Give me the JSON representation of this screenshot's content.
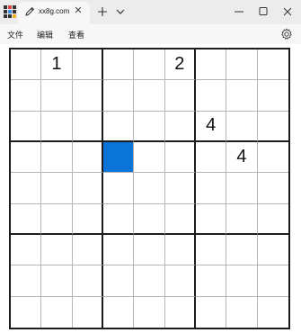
{
  "tab": {
    "title": "xx8g.com",
    "close_glyph": "✕",
    "icon": "pencil-icon"
  },
  "window_controls": [
    "minimize-icon",
    "maximize-icon",
    "close-icon"
  ],
  "menu": {
    "file": "文件",
    "edit": "编辑",
    "view": "查看"
  },
  "board": {
    "size": 9,
    "selected": {
      "row": 3,
      "col": 3
    },
    "selected_color": "#0a74d8",
    "cells": [
      [
        "",
        "1",
        "",
        "",
        "",
        "2",
        "",
        "",
        ""
      ],
      [
        "",
        "",
        "",
        "",
        "",
        "",
        "",
        "",
        ""
      ],
      [
        "",
        "",
        "",
        "",
        "",
        "",
        "4",
        "",
        ""
      ],
      [
        "",
        "",
        "",
        "",
        "",
        "",
        "",
        "4",
        ""
      ],
      [
        "",
        "",
        "",
        "",
        "",
        "",
        "",
        "",
        ""
      ],
      [
        "",
        "",
        "",
        "",
        "",
        "",
        "",
        "",
        ""
      ],
      [
        "",
        "",
        "",
        "",
        "",
        "",
        "",
        "",
        ""
      ],
      [
        "",
        "",
        "",
        "",
        "",
        "",
        "",
        "",
        ""
      ],
      [
        "",
        "",
        "",
        "",
        "",
        "",
        "",
        "",
        ""
      ]
    ]
  }
}
